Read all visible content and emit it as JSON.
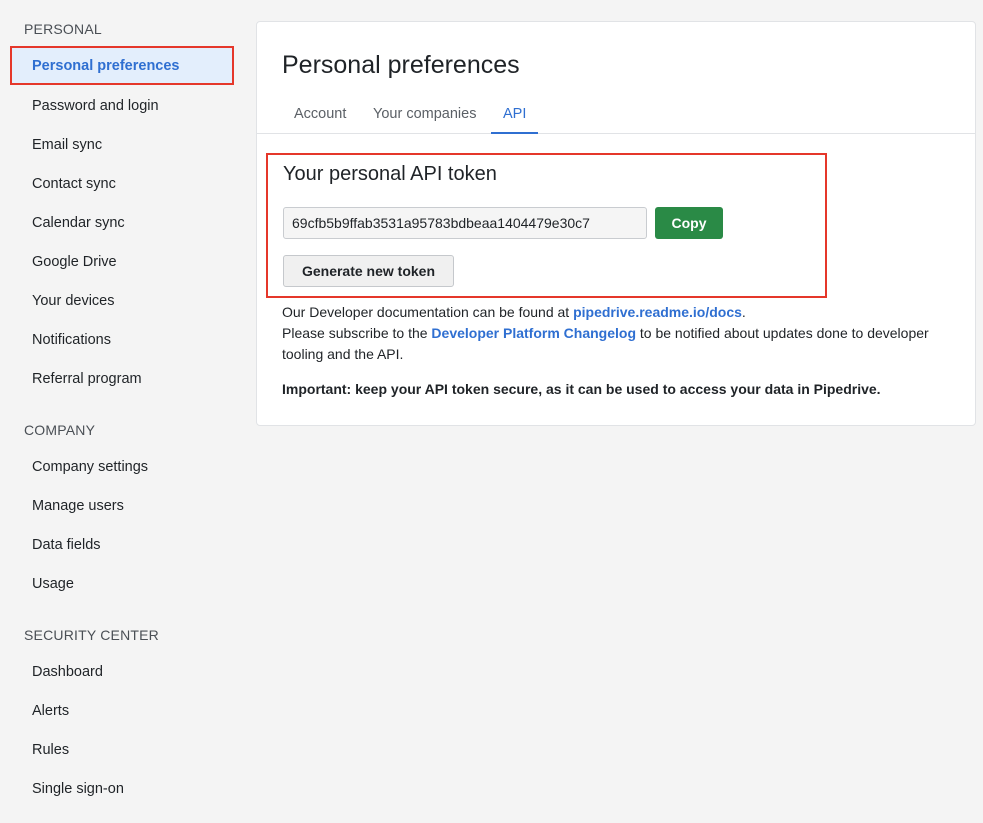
{
  "sidebar": {
    "sections": [
      {
        "title": "PERSONAL",
        "items": [
          {
            "label": "Personal preferences",
            "active": true
          },
          {
            "label": "Password and login"
          },
          {
            "label": "Email sync"
          },
          {
            "label": "Contact sync"
          },
          {
            "label": "Calendar sync"
          },
          {
            "label": "Google Drive"
          },
          {
            "label": "Your devices"
          },
          {
            "label": "Notifications"
          },
          {
            "label": "Referral program"
          }
        ]
      },
      {
        "title": "COMPANY",
        "items": [
          {
            "label": "Company settings"
          },
          {
            "label": "Manage users"
          },
          {
            "label": "Data fields"
          },
          {
            "label": "Usage"
          }
        ]
      },
      {
        "title": "SECURITY CENTER",
        "items": [
          {
            "label": "Dashboard"
          },
          {
            "label": "Alerts"
          },
          {
            "label": "Rules"
          },
          {
            "label": "Single sign-on"
          }
        ]
      }
    ]
  },
  "main": {
    "title": "Personal preferences",
    "tabs": [
      {
        "label": "Account"
      },
      {
        "label": "Your companies"
      },
      {
        "label": "API",
        "active": true
      }
    ],
    "token": {
      "heading": "Your personal API token",
      "value": "69cfb5b9ffab3531a95783bdbeaa1404479e30c7",
      "copy_label": "Copy",
      "generate_label": "Generate new token"
    },
    "info": {
      "docs_text": "Our Developer documentation can be found at ",
      "docs_link": "pipedrive.readme.io/docs",
      "docs_end": ".",
      "subscribe_text": "Please subscribe to the ",
      "changelog_link": "Developer Platform Changelog",
      "subscribe_end": " to be notified about updates done to developer tooling and the API.",
      "important": "Important: keep your API token secure, as it can be used to access your data in Pipedrive."
    },
    "colors": {
      "accent": "#2f6fd1",
      "copy_button": "#2a8a46",
      "highlight_border": "#e5372a"
    }
  }
}
